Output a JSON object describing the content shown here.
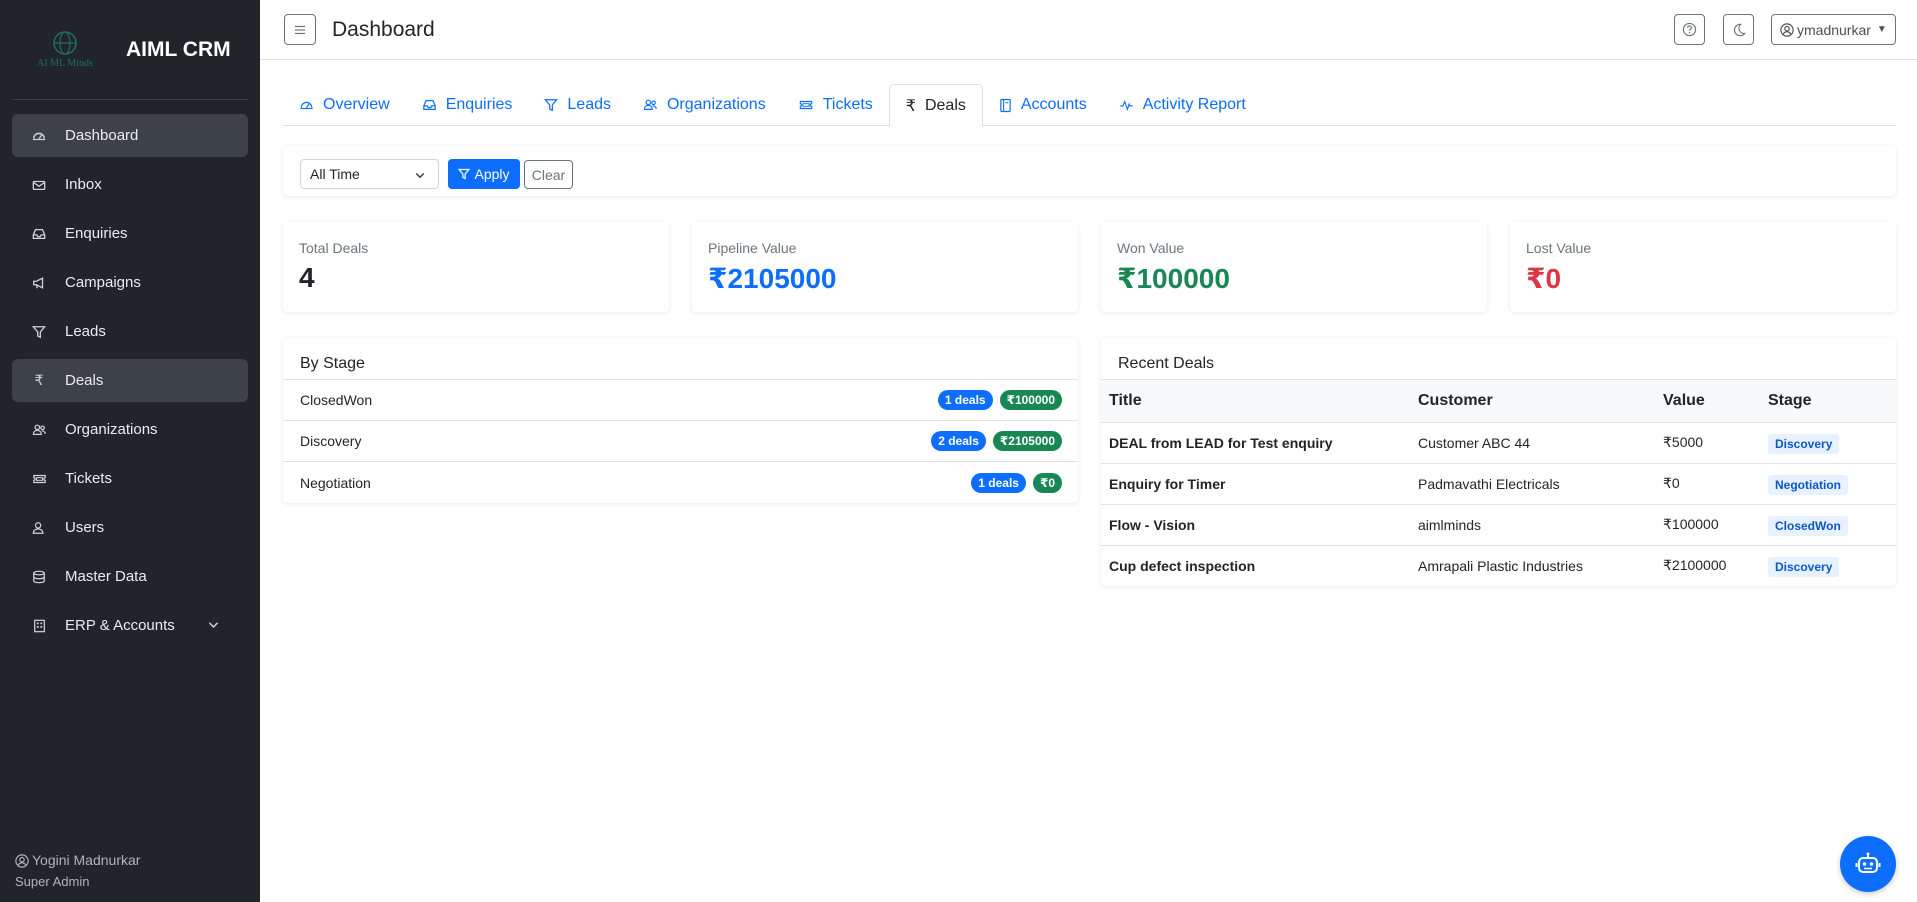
{
  "brand": {
    "logo_text": "AI ML Minds",
    "name": "AIML CRM"
  },
  "sidebar": {
    "items": [
      {
        "label": "Dashboard",
        "icon": "dashboard-icon",
        "active": true
      },
      {
        "label": "Inbox",
        "icon": "inbox-icon"
      },
      {
        "label": "Enquiries",
        "icon": "enquiries-icon"
      },
      {
        "label": "Campaigns",
        "icon": "megaphone-icon"
      },
      {
        "label": "Leads",
        "icon": "funnel-icon"
      },
      {
        "label": "Deals",
        "icon": "rupee-icon",
        "active": true
      },
      {
        "label": "Organizations",
        "icon": "people-icon"
      },
      {
        "label": "Tickets",
        "icon": "ticket-icon"
      },
      {
        "label": "Users",
        "icon": "user-icon"
      },
      {
        "label": "Master Data",
        "icon": "database-icon"
      },
      {
        "label": "ERP & Accounts",
        "icon": "building-icon"
      }
    ],
    "user": {
      "name": "Yogini Madnurkar",
      "role": "Super Admin"
    }
  },
  "header": {
    "title": "Dashboard",
    "username": "ymadnurkar"
  },
  "tabs": [
    {
      "label": "Overview",
      "icon": "speedometer-icon"
    },
    {
      "label": "Enquiries",
      "icon": "inbox-icon"
    },
    {
      "label": "Leads",
      "icon": "funnel-icon"
    },
    {
      "label": "Organizations",
      "icon": "people-icon"
    },
    {
      "label": "Tickets",
      "icon": "ticket-icon"
    },
    {
      "label": "Deals",
      "icon": "rupee-icon",
      "active": true
    },
    {
      "label": "Accounts",
      "icon": "journal-icon"
    },
    {
      "label": "Activity Report",
      "icon": "activity-icon"
    }
  ],
  "filter": {
    "period": "All Time",
    "apply_label": "Apply",
    "clear_label": "Clear"
  },
  "stats": [
    {
      "label": "Total Deals",
      "value": "4",
      "color": "#212529"
    },
    {
      "label": "Pipeline Value",
      "value": "₹2105000",
      "color": "#0d6efd"
    },
    {
      "label": "Won Value",
      "value": "₹100000",
      "color": "#198754"
    },
    {
      "label": "Lost Value",
      "value": "₹0",
      "color": "#dc3545"
    }
  ],
  "by_stage": {
    "title": "By Stage",
    "rows": [
      {
        "stage": "ClosedWon",
        "count": "1 deals",
        "value": "₹100000"
      },
      {
        "stage": "Discovery",
        "count": "2 deals",
        "value": "₹2105000"
      },
      {
        "stage": "Negotiation",
        "count": "1 deals",
        "value": "₹0"
      }
    ]
  },
  "recent_deals": {
    "title": "Recent Deals",
    "columns": [
      "Title",
      "Customer",
      "Value",
      "Stage"
    ],
    "rows": [
      {
        "title": "DEAL from LEAD for Test enquiry",
        "customer": "Customer ABC 44",
        "value": "₹5000",
        "stage": "Discovery"
      },
      {
        "title": "Enquiry for Timer",
        "customer": "Padmavathi Electricals",
        "value": "₹0",
        "stage": "Negotiation"
      },
      {
        "title": "Flow - Vision",
        "customer": "aimlminds",
        "value": "₹100000",
        "stage": "ClosedWon"
      },
      {
        "title": "Cup defect inspection",
        "customer": "Amrapali Plastic Industries",
        "value": "₹2100000",
        "stage": "Discovery"
      }
    ]
  }
}
